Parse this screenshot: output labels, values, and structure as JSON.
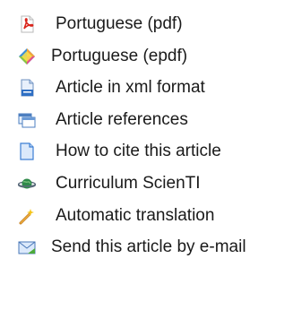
{
  "menu": {
    "items": [
      {
        "label": "Portuguese (pdf)",
        "icon": "pdf-icon"
      },
      {
        "label": "Portuguese (epdf)",
        "icon": "epdf-icon"
      },
      {
        "label": "Article in xml format",
        "icon": "xml-document-icon"
      },
      {
        "label": "Article references",
        "icon": "references-window-icon"
      },
      {
        "label": " How to cite this article",
        "icon": "document-icon"
      },
      {
        "label": "Curriculum ScienTI",
        "icon": "planet-icon"
      },
      {
        "label": "Automatic translation",
        "icon": "magic-wand-icon"
      },
      {
        "label": "Send this article by e-mail",
        "icon": "envelope-icon"
      }
    ]
  },
  "colors": {
    "text": "#1a1a1a",
    "pdf_red": "#d9251c",
    "doc_blue": "#3d7fd4",
    "envelope_green": "#4caa3a"
  }
}
